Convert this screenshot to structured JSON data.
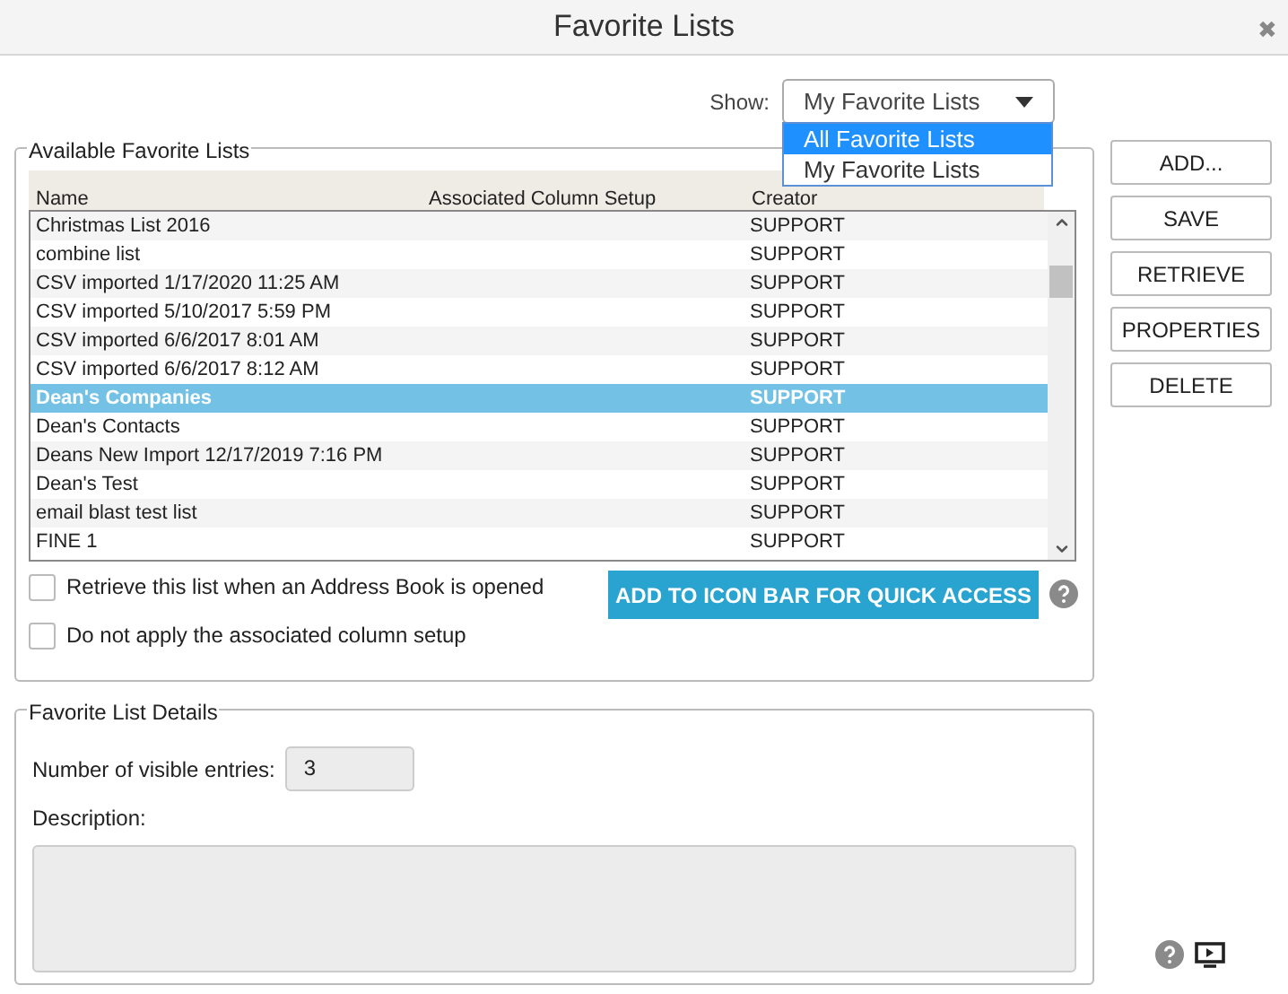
{
  "window": {
    "title": "Favorite Lists",
    "close": "✖"
  },
  "show": {
    "label": "Show:",
    "value": "My Favorite Lists",
    "options": [
      {
        "label": "All Favorite Lists",
        "highlighted": true
      },
      {
        "label": "My Favorite Lists",
        "highlighted": false
      }
    ]
  },
  "available": {
    "title": "Available Favorite Lists",
    "columns": [
      "Name",
      "Associated Column Setup",
      "Creator"
    ],
    "rows": [
      {
        "name": "Christmas List 2016",
        "creator": "SUPPORT",
        "selected": false
      },
      {
        "name": "combine list",
        "creator": "SUPPORT",
        "selected": false
      },
      {
        "name": "CSV imported 1/17/2020 11:25 AM",
        "creator": "SUPPORT",
        "selected": false
      },
      {
        "name": "CSV imported 5/10/2017 5:59 PM",
        "creator": "SUPPORT",
        "selected": false
      },
      {
        "name": "CSV imported 6/6/2017 8:01 AM",
        "creator": "SUPPORT",
        "selected": false
      },
      {
        "name": "CSV imported 6/6/2017 8:12 AM",
        "creator": "SUPPORT",
        "selected": false
      },
      {
        "name": "Dean's Companies",
        "creator": "SUPPORT",
        "selected": true
      },
      {
        "name": "Dean's Contacts",
        "creator": "SUPPORT",
        "selected": false
      },
      {
        "name": "Deans New Import 12/17/2019 7:16 PM",
        "creator": "SUPPORT",
        "selected": false
      },
      {
        "name": "Dean's Test",
        "creator": "SUPPORT",
        "selected": false
      },
      {
        "name": "email blast test list",
        "creator": "SUPPORT",
        "selected": false
      },
      {
        "name": "FINE 1",
        "creator": "SUPPORT",
        "selected": false
      }
    ],
    "options": [
      {
        "label": "Retrieve this list when an Address Book is opened",
        "checked": false
      },
      {
        "label": "Do not apply the associated column setup",
        "checked": false
      }
    ],
    "quick_access_button": "ADD TO ICON BAR FOR QUICK ACCESS"
  },
  "buttons": [
    "ADD...",
    "SAVE",
    "RETRIEVE",
    "PROPERTIES",
    "DELETE"
  ],
  "details": {
    "title": "Favorite List Details",
    "entries_label": "Number of visible entries:",
    "entries_value": "3",
    "description_label": "Description:"
  }
}
